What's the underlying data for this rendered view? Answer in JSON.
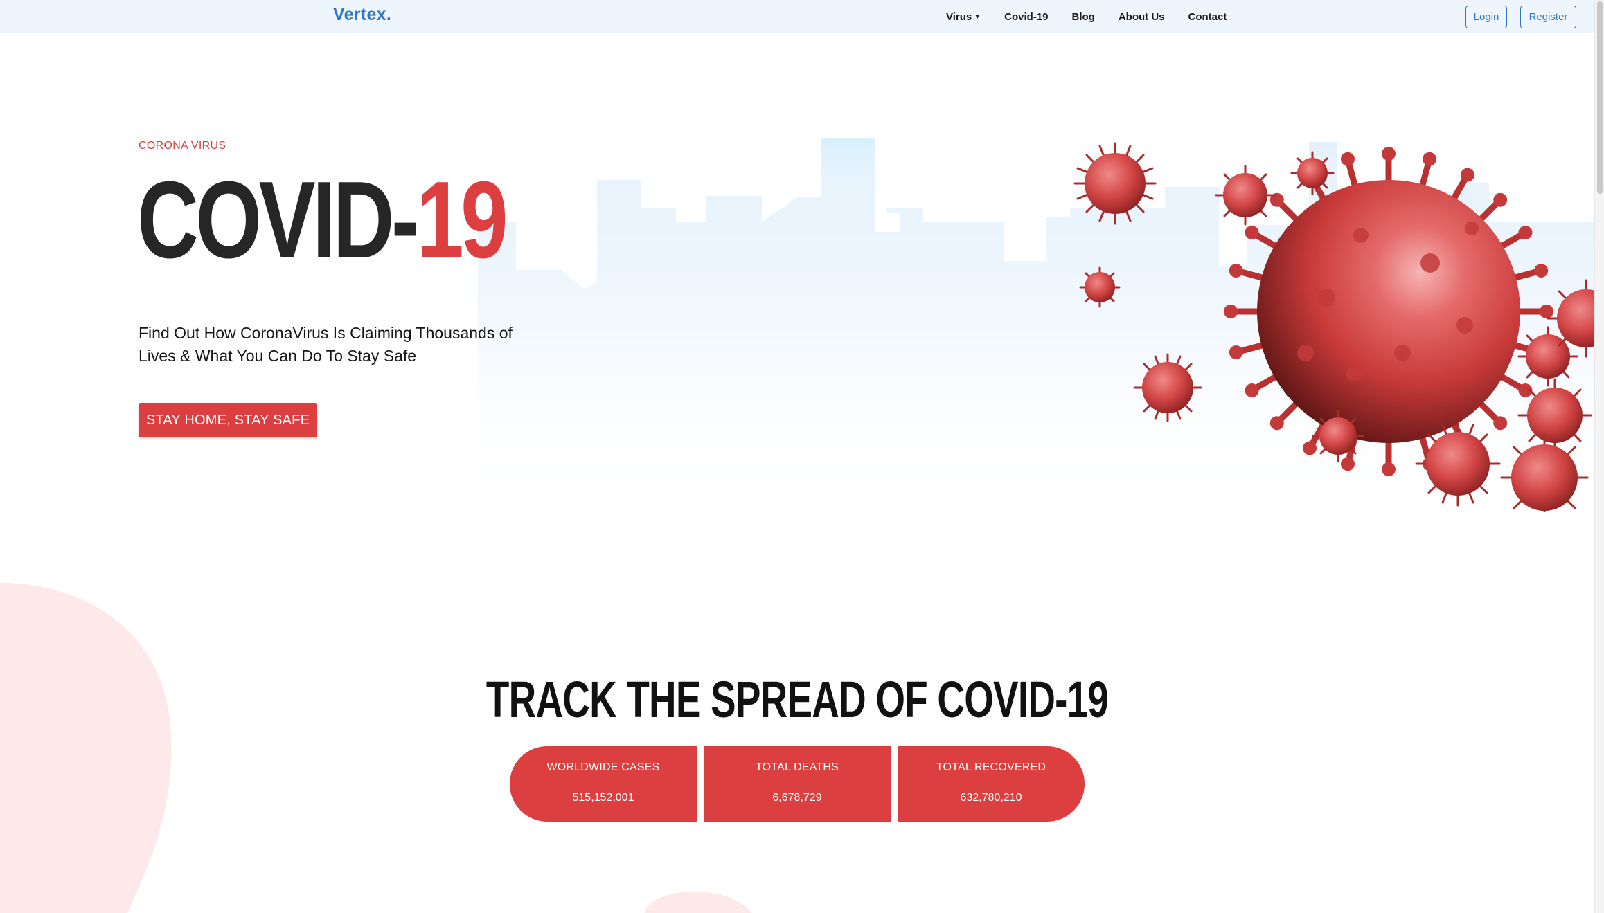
{
  "brand": {
    "logo": "Vertex."
  },
  "nav": {
    "items": [
      {
        "label": "Virus",
        "has_dropdown": true
      },
      {
        "label": "Covid-19"
      },
      {
        "label": "Blog"
      },
      {
        "label": "About Us"
      },
      {
        "label": "Contact"
      }
    ],
    "login_label": "Login",
    "register_label": "Register"
  },
  "hero": {
    "eyebrow": "CORONA VIRUS",
    "title_main": "COVID-",
    "title_accent": "19",
    "subtitle": "Find Out How CoronaVirus Is Claiming Thousands of Lives & What You Can Do To Stay Safe",
    "cta_label": "STAY HOME, STAY SAFE"
  },
  "track": {
    "title": "TRACK THE SPREAD OF COVID-19",
    "stats": [
      {
        "label": "WORLDWIDE CASES",
        "value": "515,152,001"
      },
      {
        "label": "TOTAL DEATHS",
        "value": "6,678,729"
      },
      {
        "label": "TOTAL RECOVERED",
        "value": "632,780,210"
      }
    ]
  },
  "colors": {
    "accent": "#dc3f3f",
    "brand": "#2f78c4",
    "nav_bg": "#eef5fc",
    "text_dark": "#262626"
  },
  "icons": [
    "virus-illustration",
    "caret-down-icon",
    "city-skyline"
  ]
}
